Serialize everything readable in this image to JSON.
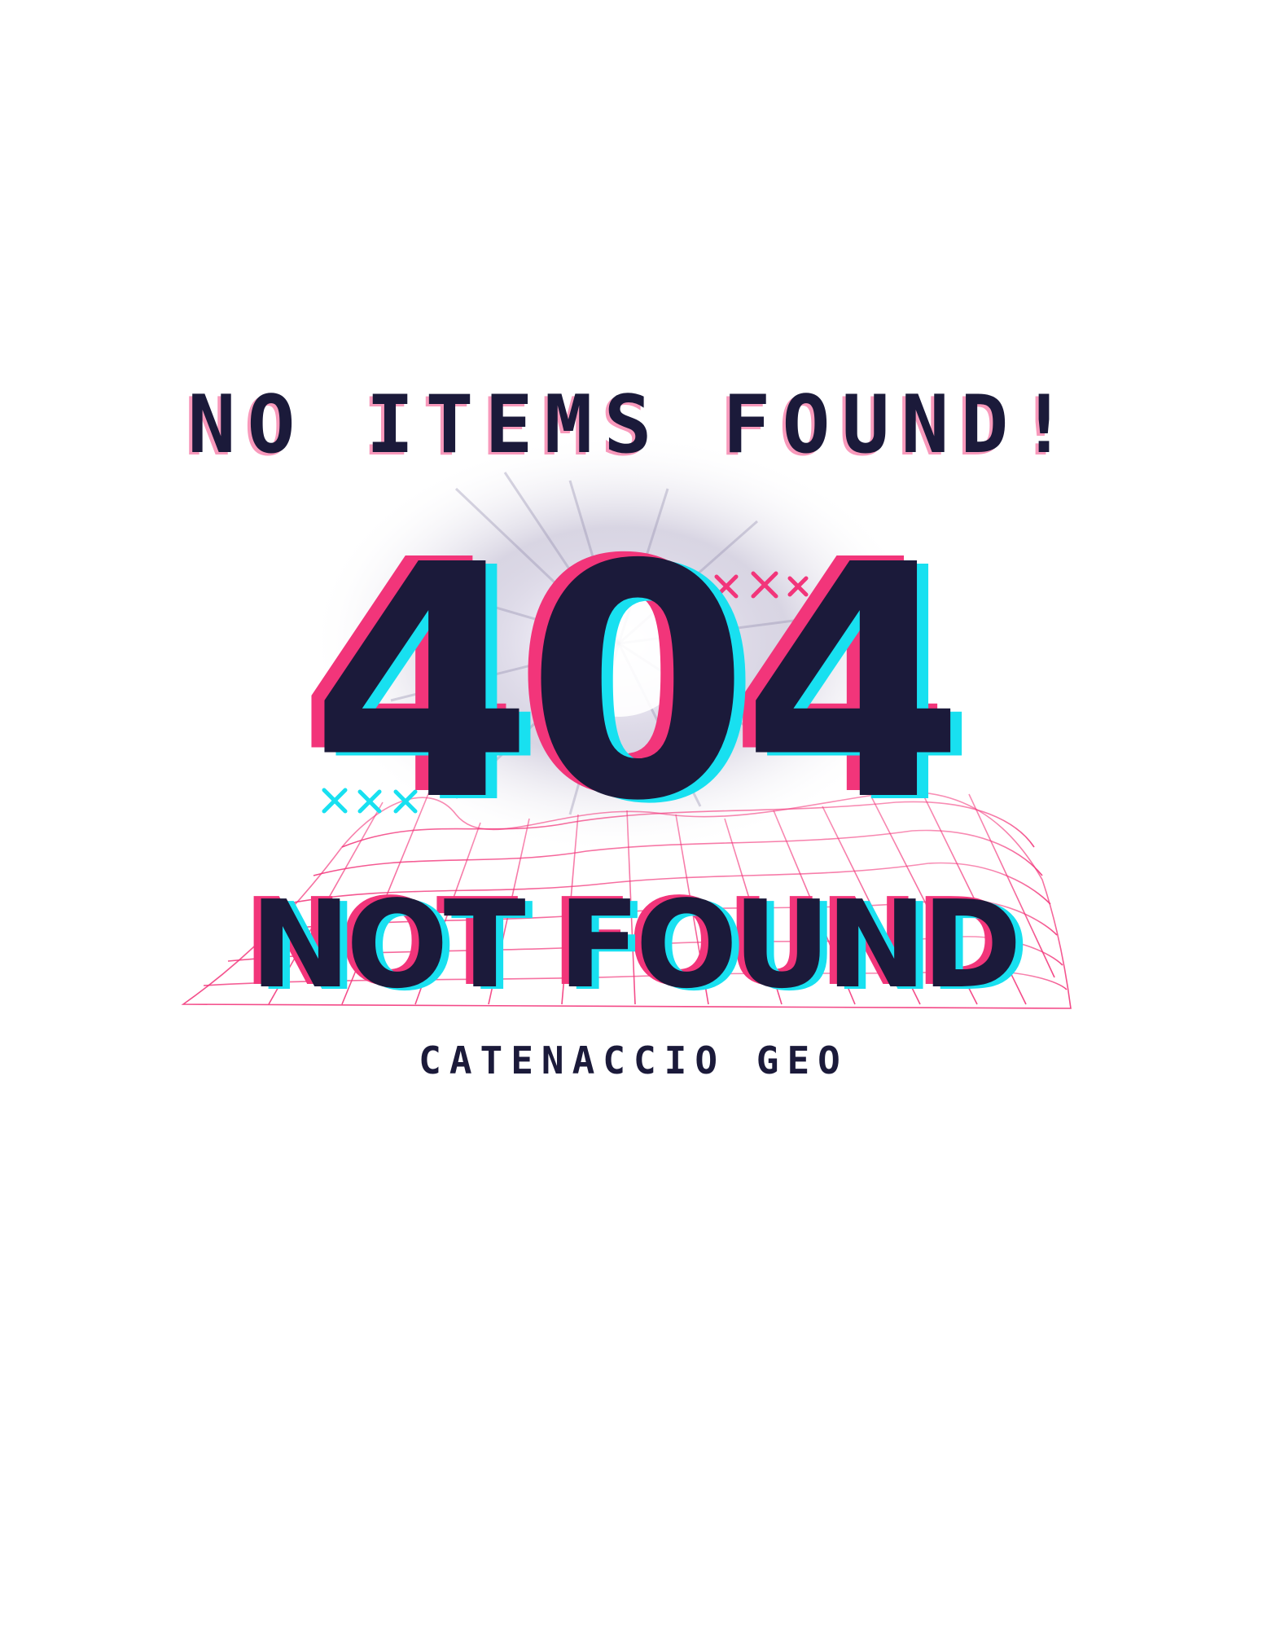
{
  "headline": "NO ITEMS FOUND!",
  "error_code": "404",
  "subtitle": "NOT FOUND",
  "brand": "CATENACCIO GEO",
  "colors": {
    "dark": "#1b1a3a",
    "pink": "#f2357a",
    "cyan": "#18e0f0"
  },
  "icons": [
    "burst-icon",
    "wireframe-grid-icon",
    "x-marks-icon"
  ]
}
